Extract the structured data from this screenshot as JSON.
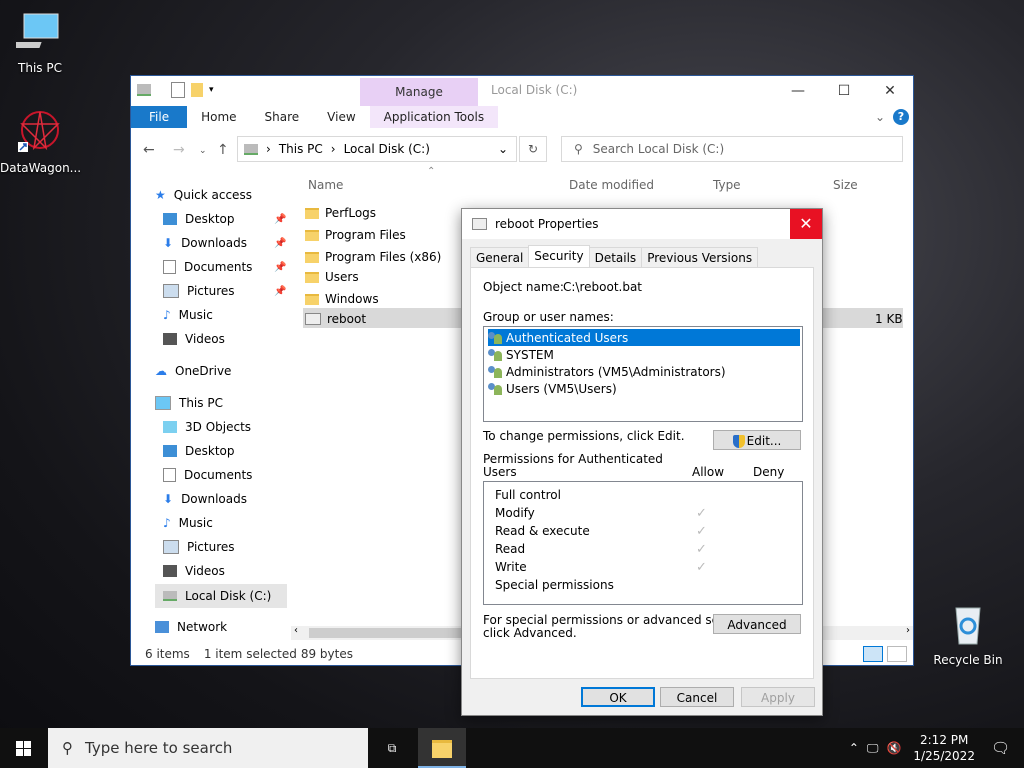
{
  "desktop": {
    "icons": [
      {
        "label": "This PC"
      },
      {
        "label": "DataWagon..."
      },
      {
        "label": "Recycle Bin"
      }
    ]
  },
  "explorer": {
    "title": "Local Disk (C:)",
    "context_tab": "Manage",
    "ribbon_tabs": [
      "File",
      "Home",
      "Share",
      "View",
      "Application Tools"
    ],
    "address": {
      "crumbs": [
        "This PC",
        "Local Disk (C:)"
      ]
    },
    "search_placeholder": "Search Local Disk (C:)",
    "nav": {
      "quick_access": "Quick access",
      "quick_items": [
        "Desktop",
        "Downloads",
        "Documents",
        "Pictures",
        "Music",
        "Videos"
      ],
      "onedrive": "OneDrive",
      "this_pc": "This PC",
      "pc_items": [
        "3D Objects",
        "Desktop",
        "Documents",
        "Downloads",
        "Music",
        "Pictures",
        "Videos",
        "Local Disk (C:)"
      ],
      "network": "Network"
    },
    "columns": {
      "name": "Name",
      "date": "Date modified",
      "type": "Type",
      "size": "Size"
    },
    "files": [
      {
        "name": "PerfLogs"
      },
      {
        "name": "Program Files"
      },
      {
        "name": "Program Files (x86)"
      },
      {
        "name": "Users"
      },
      {
        "name": "Windows"
      },
      {
        "name": "reboot",
        "size": "1 KB"
      }
    ],
    "status": {
      "count": "6 items",
      "selected": "1 item selected",
      "bytes": "89 bytes"
    }
  },
  "dialog": {
    "title": "reboot Properties",
    "tabs": [
      "General",
      "Security",
      "Details",
      "Previous Versions"
    ],
    "active_tab": "Security",
    "object_label": "Object name:",
    "object_value": "C:\\reboot.bat",
    "group_label": "Group or user names:",
    "users": [
      "Authenticated Users",
      "SYSTEM",
      "Administrators (VM5\\Administrators)",
      "Users (VM5\\Users)"
    ],
    "change_text": "To change permissions, click Edit.",
    "edit_button": "Edit...",
    "perm_header_1": "Permissions for Authenticated",
    "perm_header_2": "Users",
    "allow_label": "Allow",
    "deny_label": "Deny",
    "permissions": [
      {
        "name": "Full control",
        "allow": false
      },
      {
        "name": "Modify",
        "allow": true
      },
      {
        "name": "Read & execute",
        "allow": true
      },
      {
        "name": "Read",
        "allow": true
      },
      {
        "name": "Write",
        "allow": true
      },
      {
        "name": "Special permissions",
        "allow": false
      }
    ],
    "advanced_text_1": "For special permissions or advanced settings,",
    "advanced_text_2": "click Advanced.",
    "advanced_button": "Advanced",
    "ok": "OK",
    "cancel": "Cancel",
    "apply": "Apply"
  },
  "taskbar": {
    "search_placeholder": "Type here to search",
    "time": "2:12 PM",
    "date": "1/25/2022"
  }
}
